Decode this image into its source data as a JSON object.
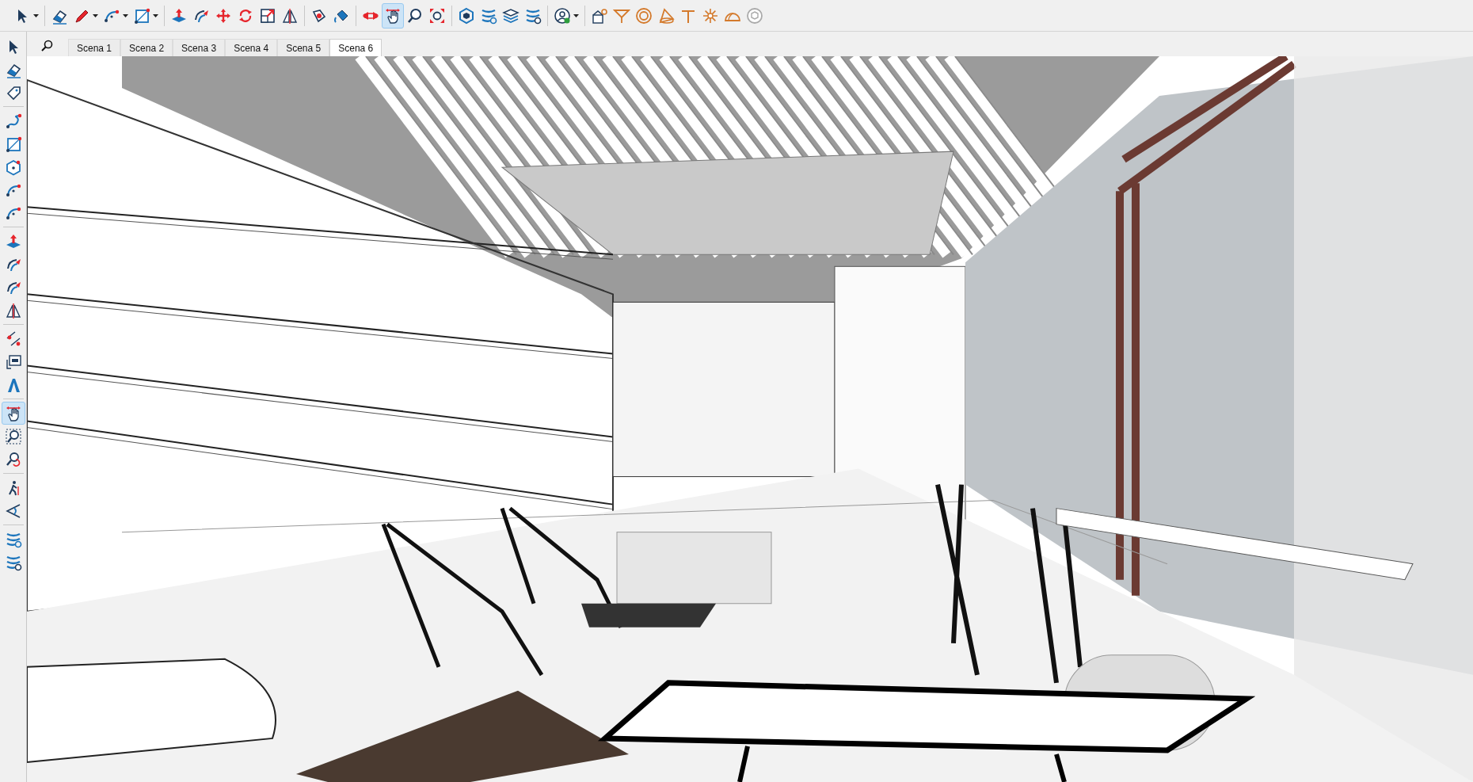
{
  "toolbar": {
    "tools": [
      {
        "selected": false
      },
      {
        "selected": false
      },
      {
        "selected": false
      },
      {
        "selected": false
      },
      {
        "selected": false
      },
      {
        "selected": false
      },
      {
        "selected": false
      },
      {
        "selected": false
      },
      {
        "selected": false
      },
      {
        "selected": false
      },
      {
        "selected": false
      },
      {
        "selected": false
      },
      {
        "selected": false
      },
      {
        "selected": false
      },
      {
        "selected": true
      },
      {
        "selected": false
      },
      {
        "selected": false
      },
      {
        "selected": false
      },
      {
        "selected": false
      },
      {
        "selected": false
      },
      {
        "selected": false
      },
      {
        "selected": false
      },
      {
        "selected": false
      },
      {
        "selected": false
      },
      {
        "selected": false
      },
      {
        "selected": false
      },
      {
        "selected": false
      },
      {
        "selected": false
      },
      {
        "selected": false
      },
      {
        "selected": false
      }
    ]
  },
  "tool_palette": {
    "tools": [
      {
        "selected": false
      },
      {
        "selected": false
      },
      {
        "selected": false
      },
      {
        "selected": false
      },
      {
        "selected": false
      },
      {
        "selected": false
      },
      {
        "selected": false
      },
      {
        "selected": false
      },
      {
        "selected": false
      },
      {
        "selected": false
      },
      {
        "selected": false
      },
      {
        "selected": false
      },
      {
        "selected": false
      },
      {
        "selected": false
      },
      {
        "selected": false
      },
      {
        "selected": true
      },
      {
        "selected": false
      },
      {
        "selected": false
      },
      {
        "selected": false
      },
      {
        "selected": false
      },
      {
        "selected": false
      },
      {
        "selected": false
      }
    ]
  },
  "scene_tabs": [
    {
      "label": "Scena 1",
      "selected": false
    },
    {
      "label": "Scena 2",
      "selected": false
    },
    {
      "label": "Scena 3",
      "selected": false
    },
    {
      "label": "Scena 4",
      "selected": false
    },
    {
      "label": "Scena 5",
      "selected": false
    },
    {
      "label": "Scena 6",
      "selected": true
    }
  ]
}
